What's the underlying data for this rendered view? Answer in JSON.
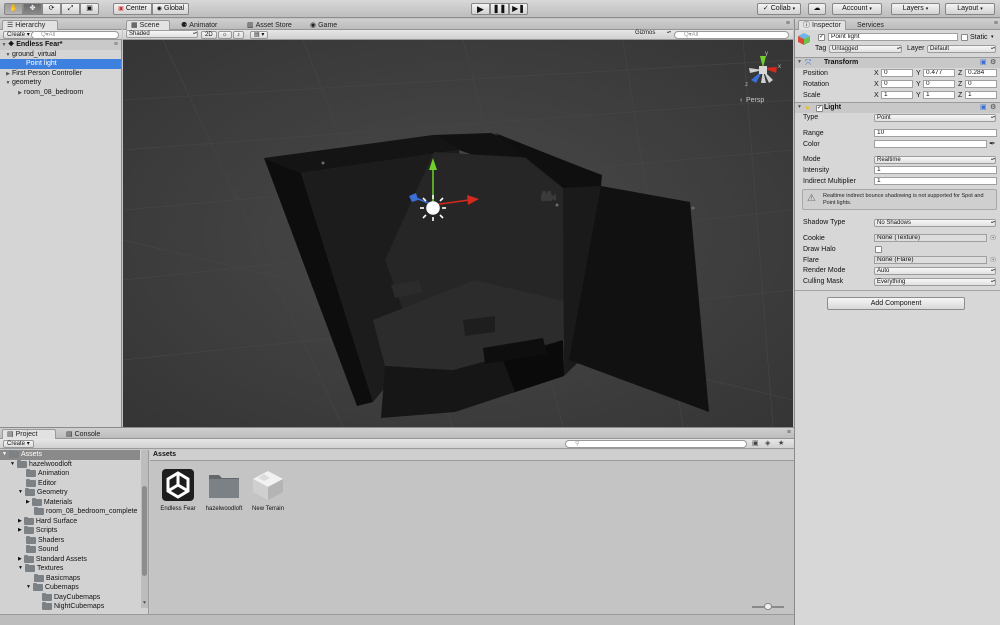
{
  "toolbar": {
    "pivot": "Center",
    "rotation": "Global",
    "collab": "Collab",
    "account": "Account",
    "layers": "Layers",
    "layout": "Layout"
  },
  "hierarchy": {
    "tab": "Hierarchy",
    "create": "Create",
    "search_placeholder": "Q▾All",
    "scene_name": "Endless Fear*",
    "rows": [
      {
        "label": "ground_virtual"
      },
      {
        "label": "Point light"
      },
      {
        "label": "First Person Controller"
      },
      {
        "label": "geometry"
      },
      {
        "label": "room_08_bedroom"
      }
    ]
  },
  "scene_tabs": {
    "scene": "Scene",
    "animator": "Animator",
    "asset_store": "Asset Store",
    "game": "Game"
  },
  "scene_bar": {
    "shading": "Shaded",
    "mode_2d": "2D",
    "gizmos": "Gizmos",
    "search_placeholder": "Q▾All"
  },
  "scene_view": {
    "projection": "Persp",
    "axis_y": "y",
    "axis_x": "x",
    "axis_z": "z"
  },
  "inspector": {
    "tab": "Inspector",
    "services_tab": "Services",
    "object_name": "Point light",
    "static_label": "Static",
    "tag_label": "Tag",
    "tag_value": "Untagged",
    "layer_label": "Layer",
    "layer_value": "Default",
    "transform": {
      "title": "Transform",
      "position_label": "Position",
      "rotation_label": "Rotation",
      "scale_label": "Scale",
      "axis_x": "X",
      "axis_y": "Y",
      "axis_z": "Z",
      "position": {
        "x": "0",
        "y": "0.477",
        "z": "0.284"
      },
      "rotation": {
        "x": "0",
        "y": "0",
        "z": "0"
      },
      "scale": {
        "x": "1",
        "y": "1",
        "z": "1"
      }
    },
    "light": {
      "title": "Light",
      "type_label": "Type",
      "type_value": "Point",
      "range_label": "Range",
      "range_value": "10",
      "color_label": "Color",
      "color_value": "#ffffff",
      "mode_label": "Mode",
      "mode_value": "Realtime",
      "intensity_label": "Intensity",
      "intensity_value": "1",
      "indirect_label": "Indirect Multiplier",
      "indirect_value": "1",
      "warning": "Realtime indirect bounce shadowing is not supported for Spot and Point lights.",
      "shadow_label": "Shadow Type",
      "shadow_value": "No Shadows",
      "cookie_label": "Cookie",
      "cookie_value": "None (Texture)",
      "halo_label": "Draw Halo",
      "flare_label": "Flare",
      "flare_value": "None (Flare)",
      "render_label": "Render Mode",
      "render_value": "Auto",
      "culling_label": "Culling Mask",
      "culling_value": "Everything"
    },
    "add_component": "Add Component"
  },
  "project": {
    "tab": "Project",
    "console_tab": "Console",
    "create": "Create",
    "tree_root": "Assets",
    "tree": [
      {
        "label": "hazelwoodloft"
      },
      {
        "label": "Animation"
      },
      {
        "label": "Editor"
      },
      {
        "label": "Geometry"
      },
      {
        "label": "Materials"
      },
      {
        "label": "room_08_bedroom_complete"
      },
      {
        "label": "Hard Surface"
      },
      {
        "label": "Scripts"
      },
      {
        "label": "Shaders"
      },
      {
        "label": "Sound"
      },
      {
        "label": "Standard Assets"
      },
      {
        "label": "Textures"
      },
      {
        "label": "Basicmaps"
      },
      {
        "label": "Cubemaps"
      },
      {
        "label": "DayCubemaps"
      },
      {
        "label": "NightCubemaps"
      }
    ],
    "breadcrumb": "Assets",
    "assets": [
      {
        "label": "Endless Fear"
      },
      {
        "label": "hazelwoodloft"
      },
      {
        "label": "New Terrain"
      }
    ]
  },
  "colors": {
    "selection": "#3d80df",
    "axis_x": "#d4291c",
    "axis_y": "#6fcf2b",
    "axis_z": "#3a6fd8"
  }
}
